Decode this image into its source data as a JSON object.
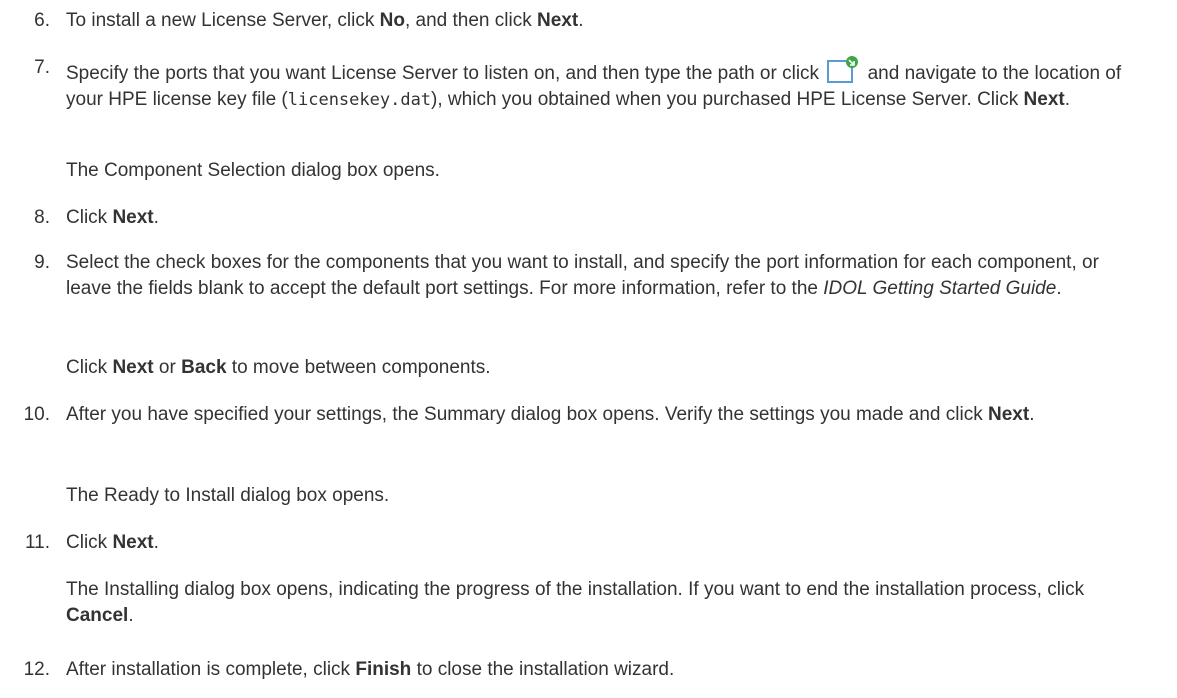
{
  "steps": [
    {
      "number": "6.",
      "parts": [
        "To install a new License Server, click ",
        "No",
        ", and then click ",
        "Next",
        "."
      ]
    },
    {
      "number": "7.",
      "parts": [
        "Specify the ports that you want License Server to listen on, and then type the path or click ",
        " and navigate to the location of your HPE license key file (",
        "licensekey.dat",
        "), which you obtained when you purchased HPE License Server. Click ",
        "Next",
        "."
      ],
      "icon": "browse-file-icon",
      "note": "The Component Selection dialog box opens."
    },
    {
      "number": "8.",
      "parts": [
        "Click ",
        "Next",
        "."
      ]
    },
    {
      "number": "9.",
      "parts": [
        "Select the check boxes for the components that you want to install, and specify the port information for each component, or leave the fields blank to accept the default port settings. For more information, refer to the ",
        "IDOL Getting Started Guide",
        "."
      ],
      "note_parts": [
        "Click ",
        "Next",
        " or ",
        "Back",
        " to move between components."
      ]
    },
    {
      "number": "10.",
      "parts": [
        "After you have specified your settings, the Summary dialog box opens. Verify the settings you made and click ",
        "Next",
        "."
      ],
      "note": "The Ready to Install dialog box opens."
    },
    {
      "number": "11.",
      "parts": [
        "Click ",
        "Next",
        "."
      ],
      "note_parts": [
        "The Installing dialog box opens, indicating the progress of the installation. If you want to end the installation process, click ",
        "Cancel",
        "."
      ]
    },
    {
      "number": "12.",
      "parts": [
        "After installation is complete, click ",
        "Finish",
        " to close the installation wizard."
      ]
    }
  ],
  "colors": {
    "text": "#333333",
    "icon_stroke": "#5b9bd5",
    "icon_badge": "#3aa845"
  }
}
